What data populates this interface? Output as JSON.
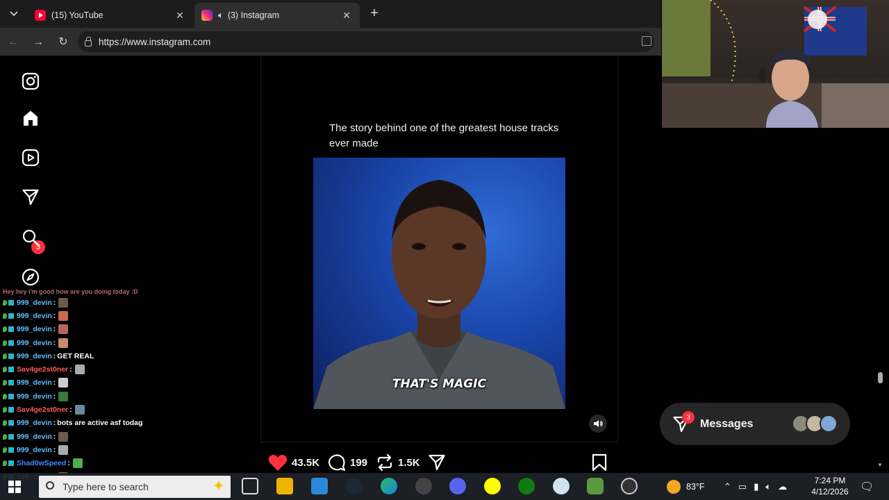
{
  "browser": {
    "tabs": [
      {
        "title": "(15) YouTube",
        "favicon": "youtube-icon",
        "active": false
      },
      {
        "title": "(3) Instagram",
        "favicon": "instagram-icon",
        "active": true,
        "audio": true
      }
    ],
    "url": "https://www.instagram.com"
  },
  "sidebar": {
    "items": [
      {
        "name": "instagram-logo-icon"
      },
      {
        "name": "home-icon"
      },
      {
        "name": "reels-icon"
      },
      {
        "name": "direct-messages-icon",
        "badge": "3"
      },
      {
        "name": "search-icon"
      },
      {
        "name": "explore-icon"
      }
    ]
  },
  "post": {
    "caption": "The story behind one of the greatest house tracks ever made",
    "video_subtitle": "THAT'S MAGIC",
    "likes": "43.5K",
    "comments": "199",
    "reposts": "1.5K"
  },
  "messages": {
    "label": "Messages",
    "badge": "3"
  },
  "chat": {
    "partial_top": "Hey hey i'm good how are you doing today :D",
    "lines": [
      {
        "user": "999_devin",
        "sep": " :",
        "msg": "",
        "color": "#5fbfff"
      },
      {
        "user": "999_devin",
        "sep": " :",
        "msg": "",
        "color": "#5fbfff"
      },
      {
        "user": "999_devin",
        "sep": " :",
        "msg": "",
        "color": "#5fbfff"
      },
      {
        "user": "999_devin",
        "sep": " :",
        "msg": "",
        "color": "#5fbfff"
      },
      {
        "user": "999_devin",
        "sep": " :",
        "msg": "GET REAL",
        "color": "#5fbfff"
      },
      {
        "user": "Sav4ge2st0ner",
        "sep": " :",
        "msg": "",
        "color": "#ff5a5a"
      },
      {
        "user": "999_devin",
        "sep": " :",
        "msg": "",
        "color": "#5fbfff"
      },
      {
        "user": "999_devin",
        "sep": " :",
        "msg": "",
        "color": "#5fbfff"
      },
      {
        "user": "Sav4ge2st0ner",
        "sep": " :",
        "msg": "",
        "color": "#ff5a5a"
      },
      {
        "user": "999_devin",
        "sep": " :",
        "msg": "bots are active asf todag",
        "color": "#5fbfff"
      },
      {
        "user": "999_devin",
        "sep": " :",
        "msg": "",
        "color": "#5fbfff"
      },
      {
        "user": "999_devin",
        "sep": " :",
        "msg": "",
        "color": "#5fbfff"
      },
      {
        "user": "Shad0wSpeed",
        "sep": " :",
        "msg": "",
        "color": "#3d8bff"
      },
      {
        "user": "999_devin",
        "sep": " :",
        "msg": "",
        "color": "#5fbfff"
      }
    ]
  },
  "taskbar": {
    "search_placeholder": "Type here to search",
    "weather": "83°F",
    "time": "7:24 PM",
    "date": "4/12/2026"
  },
  "colors": {
    "like": "#ff3040",
    "badge": "#ff3040",
    "link_blue": "#5fbfff"
  }
}
